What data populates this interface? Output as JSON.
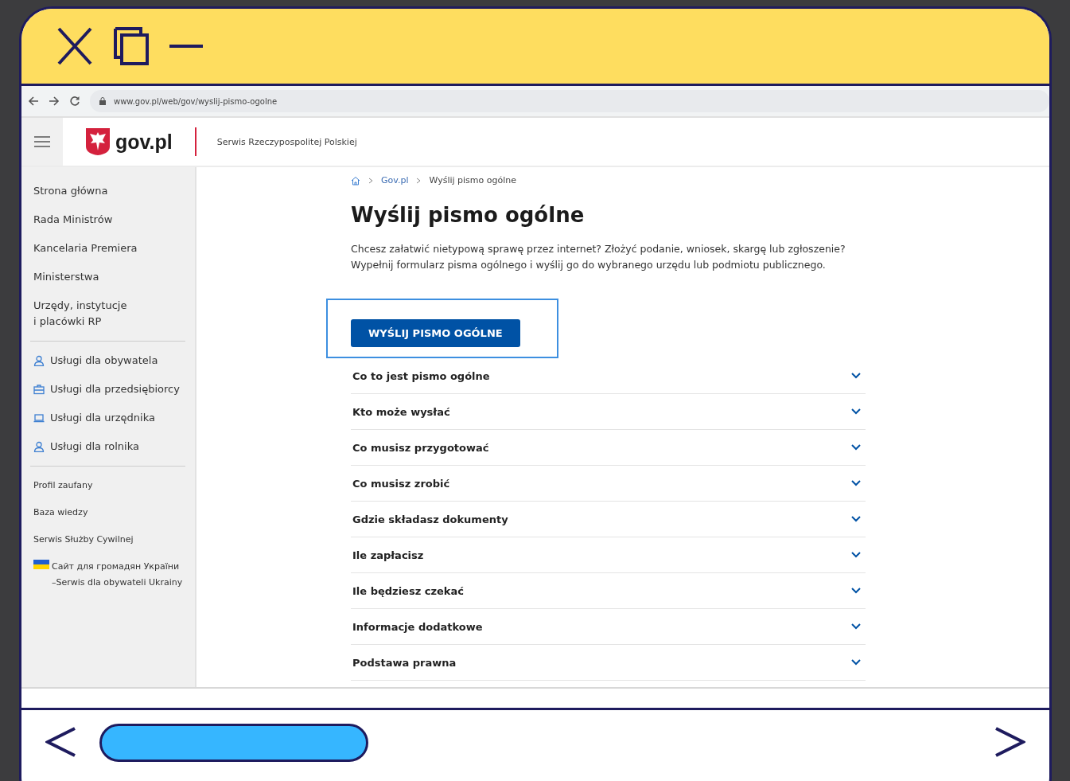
{
  "browser": {
    "url": "www.gov.pl/web/gov/wyslij-pismo-ogolne"
  },
  "site_header": {
    "logo": "gov.pl",
    "tagline": "Serwis Rzeczypospolitej Polskiej"
  },
  "sidebar": {
    "main_links": [
      "Strona główna",
      "Rada Ministrów",
      "Kancelaria Premiera",
      "Ministerstwa",
      "Urzędy, instytucje\ni placówki RP"
    ],
    "service_links": [
      {
        "label": "Usługi dla obywatela",
        "kind": "person"
      },
      {
        "label": "Usługi dla przedsiębiorcy",
        "kind": "briefcase"
      },
      {
        "label": "Usługi dla urzędnika",
        "kind": "laptop"
      },
      {
        "label": "Usługi dla rolnika",
        "kind": "person"
      }
    ],
    "extra_links": [
      {
        "label": "Profil zaufany",
        "kind": "plain"
      },
      {
        "label": "Baza wiedzy",
        "kind": "plain"
      },
      {
        "label": "Serwis Służby Cywilnej",
        "kind": "plain"
      },
      {
        "label": "Сайт для громадян України\n–Serwis dla obywateli Ukrainy",
        "kind": "flag"
      }
    ]
  },
  "breadcrumbs": [
    "Gov.pl",
    "Wyślij pismo ogólne"
  ],
  "title": "Wyślij pismo ogólne",
  "intro": "Chcesz załatwić nietypową sprawę przez internet? Złożyć podanie, wniosek, skargę lub zgłoszenie?\nWypełnij formularz pisma ogólnego i wyślij go do wybranego urzędu lub podmiotu publicznego.",
  "primary_button": "WYŚLIJ PISMO OGÓLNE",
  "accordion": [
    {
      "label": "Co to jest pismo ogólne",
      "expanded": false
    },
    {
      "label": "Kto może wysłać",
      "expanded": false
    },
    {
      "label": "Co musisz przygotować",
      "expanded": false
    },
    {
      "label": "Co musisz zrobić",
      "expanded": false
    },
    {
      "label": "Gdzie składasz dokumenty",
      "expanded": false
    },
    {
      "label": "Ile zapłacisz",
      "expanded": false
    },
    {
      "label": "Ile będziesz czekać",
      "expanded": false
    },
    {
      "label": "Informacje dodatkowe",
      "expanded": false
    },
    {
      "label": "Podstawa prawna",
      "expanded": false
    }
  ]
}
